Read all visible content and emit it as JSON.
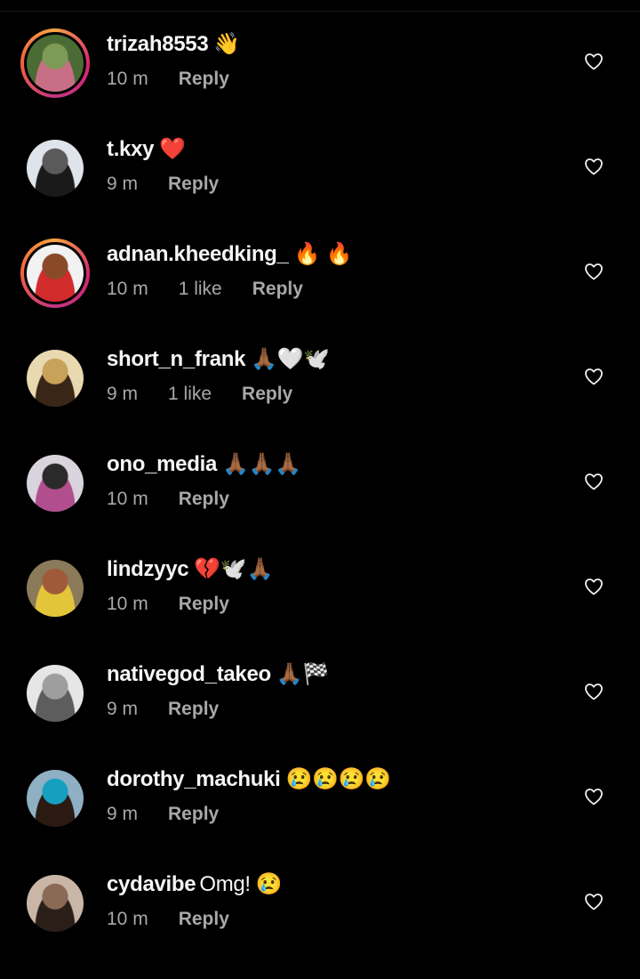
{
  "comments": [
    {
      "username": "trizah8553",
      "text": "",
      "emoji": "👋",
      "time": "10 m",
      "likes": "",
      "reply": "Reply",
      "ring": true,
      "avatar_colors": [
        "#4b6b34",
        "#c86f86",
        "#7d9a56"
      ]
    },
    {
      "username": "t.kxy",
      "text": "",
      "emoji": "❤️",
      "time": "9 m",
      "likes": "",
      "reply": "Reply",
      "ring": false,
      "avatar_colors": [
        "#dfe4ea",
        "#1a1a1a",
        "#5a5a5a"
      ]
    },
    {
      "username": "adnan.kheedking_",
      "text": "",
      "emoji": "🔥 🔥",
      "time": "10 m",
      "likes": "1 like",
      "reply": "Reply",
      "ring": true,
      "avatar_colors": [
        "#f2f2f2",
        "#d22b2b",
        "#8a4a2a"
      ]
    },
    {
      "username": "short_n_frank",
      "text": "",
      "emoji": "🙏🏾🤍🕊️",
      "time": "9 m",
      "likes": "1 like",
      "reply": "Reply",
      "ring": false,
      "avatar_colors": [
        "#e8d9b0",
        "#3a2616",
        "#c9a25a"
      ]
    },
    {
      "username": "ono_media",
      "text": "",
      "emoji": "🙏🏾🙏🏾🙏🏾",
      "time": "10 m",
      "likes": "",
      "reply": "Reply",
      "ring": false,
      "avatar_colors": [
        "#d8d3dc",
        "#b14f8e",
        "#2a2a2a"
      ]
    },
    {
      "username": "lindzyyc",
      "text": "",
      "emoji": "💔🕊️🙏🏾",
      "time": "10 m",
      "likes": "",
      "reply": "Reply",
      "ring": false,
      "avatar_colors": [
        "#8a7a5a",
        "#e3c53a",
        "#a05a3a"
      ]
    },
    {
      "username": "nativegod_takeo",
      "text": "",
      "emoji": "🙏🏾🏁",
      "time": "9 m",
      "likes": "",
      "reply": "Reply",
      "ring": false,
      "avatar_colors": [
        "#e6e6e6",
        "#5d5d5d",
        "#9e9e9e"
      ]
    },
    {
      "username": "dorothy_machuki",
      "text": "",
      "emoji": "😢😢😢😢",
      "time": "9 m",
      "likes": "",
      "reply": "Reply",
      "ring": false,
      "avatar_colors": [
        "#8fb0c4",
        "#2a1a12",
        "#16a0c0"
      ]
    },
    {
      "username": "cydavibe",
      "text": "Omg!",
      "emoji": "😢",
      "time": "10 m",
      "likes": "",
      "reply": "Reply",
      "ring": false,
      "avatar_colors": [
        "#c9b6a6",
        "#2a1e18",
        "#8a6a55"
      ]
    }
  ],
  "icons": {
    "like": "heart-outline-icon"
  },
  "colors": {
    "background": "#000000",
    "text": "#f5f5f5",
    "meta": "#a8a8a8",
    "ring_start": "#f7a542",
    "ring_end": "#c13584"
  }
}
